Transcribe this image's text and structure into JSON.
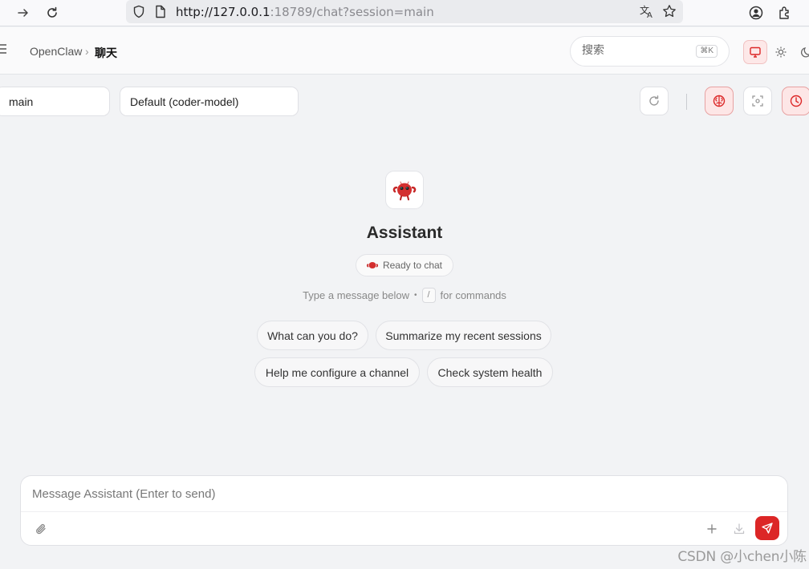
{
  "browser": {
    "url_host": "http://127.0.0.1",
    "url_rest": ":18789/chat?session=main"
  },
  "header": {
    "breadcrumb_home": "OpenClaw",
    "breadcrumb_sep": "›",
    "breadcrumb_current": "聊天",
    "search_placeholder": "搜索",
    "search_shortcut": "⌘K"
  },
  "controls": {
    "session_value": "main",
    "model_value": "Default (coder-model)"
  },
  "assistant": {
    "name": "Assistant",
    "status": "Ready to chat",
    "hint_before": "Type a message below",
    "hint_dot": "•",
    "hint_key": "/",
    "hint_after": "for commands"
  },
  "suggestions": [
    "What can you do?",
    "Summarize my recent sessions",
    "Help me configure a channel",
    "Check system health"
  ],
  "composer": {
    "placeholder": "Message Assistant (Enter to send)"
  },
  "colors": {
    "accent": "#dc2626",
    "accent_soft": "#fde6e6"
  },
  "watermark": "CSDN @小chen小陈"
}
